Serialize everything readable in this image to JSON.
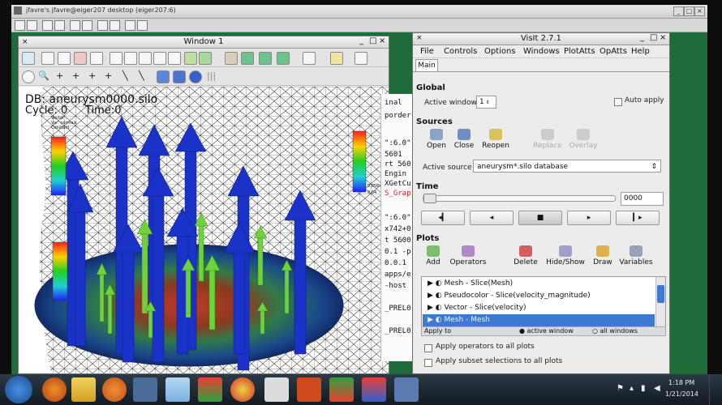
{
  "remote_desktop": {
    "title": "jfavre's jfavre@eiger207 desktop (eiger207:6)",
    "bg_color": "#1f6b3a"
  },
  "window1": {
    "title": "Window 1",
    "db_label": "DB: aneurysm0000.silo",
    "cycle_label": "Cycle: 0",
    "time_label": "Time:0",
    "legend_left_title": "Vector\nVar: normals\nConstant",
    "legend_right_values": [
      "0.05642",
      "0.04"
    ]
  },
  "terminal": {
    "lines": [
      "inal",
      "porder",
      "",
      "\":6.0\"",
      "5601",
      "rt 560",
      "Engin",
      "XGetCu",
      "S_Grap",
      "",
      "\":6.0\"",
      "x742+0",
      "t 5600",
      "0.1 -p",
      "0.0.1",
      "apps/e",
      "-host",
      "",
      "_PREL0",
      "",
      "_PREL0"
    ]
  },
  "visit": {
    "title": "VisIt 2.7.1",
    "menu": [
      "File",
      "Controls",
      "Options",
      "Windows",
      "PlotAtts",
      "OpAtts",
      "Help"
    ],
    "tab": "Main",
    "global": {
      "heading": "Global",
      "active_window_label": "Active window",
      "active_window_value": "1",
      "auto_apply_label": "Auto apply"
    },
    "sources": {
      "heading": "Sources",
      "buttons": [
        "Open",
        "Close",
        "Reopen",
        "Replace",
        "Overlay"
      ],
      "active_source_label": "Active source",
      "active_source_value": "aneurysm*.silo database"
    },
    "time": {
      "heading": "Time",
      "value": "0000",
      "slider_fraction": 0.0
    },
    "plots": {
      "heading": "Plots",
      "buttons": [
        "Add",
        "Operators",
        "Delete",
        "Hide/Show",
        "Draw",
        "Variables"
      ],
      "items": [
        "Mesh - Slice(Mesh)",
        "Pseudocolor - Slice(velocity_magnitude)",
        "Vector - Slice(velocity)",
        "Mesh - Mesh"
      ],
      "selected_index": 3,
      "apply_to_label": "Apply to",
      "apply_options": [
        "active window",
        "all windows"
      ],
      "apply_ops_label": "Apply operators to all plots",
      "apply_subset_label": "Apply subset selections to all plots"
    }
  },
  "taskbar": {
    "time": "1:18 PM",
    "date": "1/21/2014"
  }
}
